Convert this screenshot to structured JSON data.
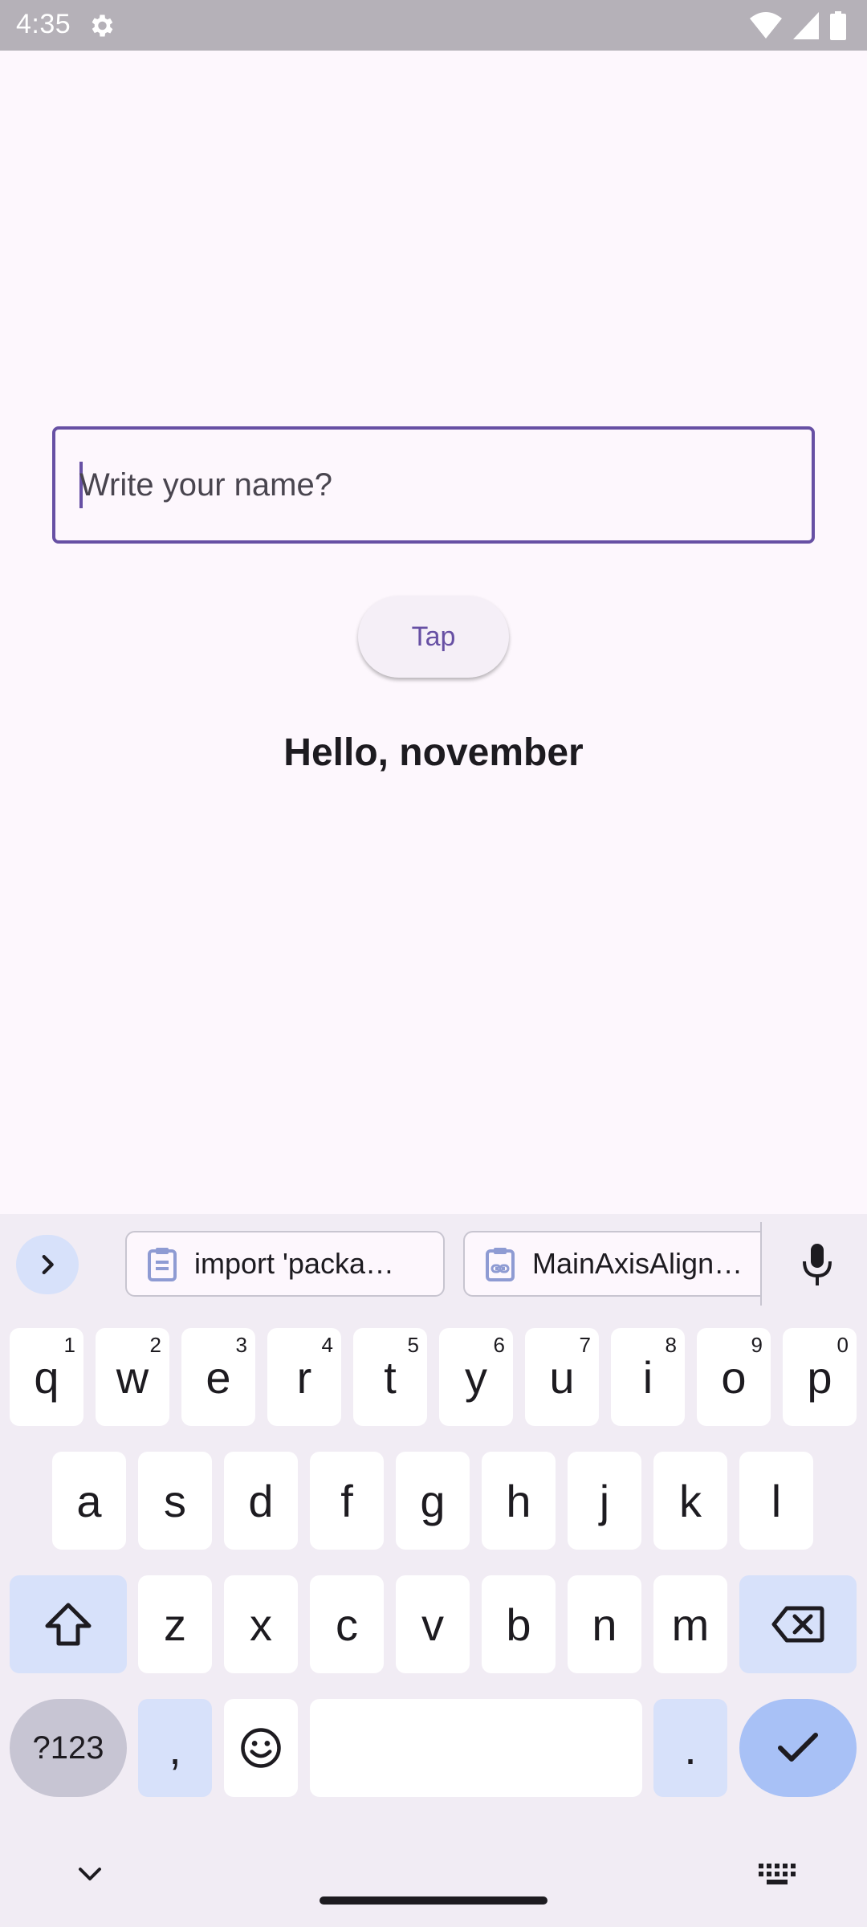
{
  "status_bar": {
    "time": "4:35",
    "icons": [
      "settings-gear-icon",
      "wifi-icon",
      "cell-signal-icon",
      "battery-icon"
    ]
  },
  "form": {
    "name_placeholder": "Write your name?",
    "name_value": "",
    "tap_label": "Tap",
    "greeting": "Hello, november"
  },
  "keyboard": {
    "clipboard": [
      {
        "text": "import 'packa…",
        "icon": "clipboard-icon"
      },
      {
        "text": "MainAxisAlign…",
        "icon": "clipboard-link-icon"
      }
    ],
    "row1": [
      {
        "label": "q",
        "hint": "1"
      },
      {
        "label": "w",
        "hint": "2"
      },
      {
        "label": "e",
        "hint": "3"
      },
      {
        "label": "r",
        "hint": "4"
      },
      {
        "label": "t",
        "hint": "5"
      },
      {
        "label": "y",
        "hint": "6"
      },
      {
        "label": "u",
        "hint": "7"
      },
      {
        "label": "i",
        "hint": "8"
      },
      {
        "label": "o",
        "hint": "9"
      },
      {
        "label": "p",
        "hint": "0"
      }
    ],
    "row2": [
      "a",
      "s",
      "d",
      "f",
      "g",
      "h",
      "j",
      "k",
      "l"
    ],
    "row3": [
      "z",
      "x",
      "c",
      "v",
      "b",
      "n",
      "m"
    ],
    "symbols_label": "?123",
    "comma_label": ",",
    "period_label": "."
  },
  "colors": {
    "accent": "#6750a4",
    "background": "#fdf7fd",
    "keyboard_bg": "#f1ecf4",
    "modifier_key": "#d7e1fa",
    "enter_key": "#a8c1f6"
  }
}
